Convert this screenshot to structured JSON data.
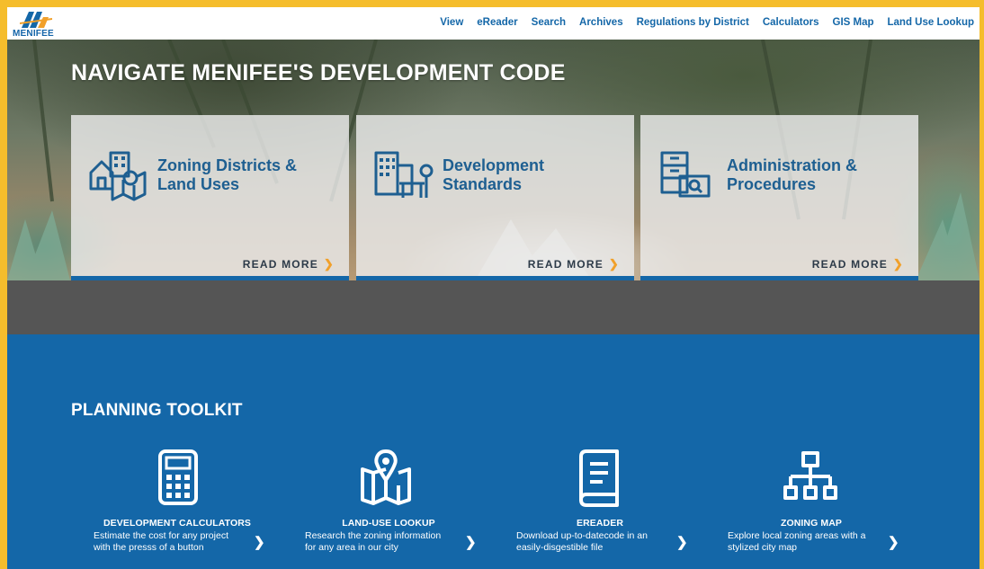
{
  "brand": {
    "name": "MENIFEE",
    "color": "#1467a8",
    "accent": "#f1a02a"
  },
  "nav": [
    "View",
    "eReader",
    "Search",
    "Archives",
    "Regulations by District",
    "Calculators",
    "GIS Map",
    "Land Use Lookup"
  ],
  "hero": {
    "title": "NAVIGATE MENIFEE'S DEVELOPMENT CODE",
    "cards": [
      {
        "icon": "zoning-map-icon",
        "title_line1": "Zoning Districts &",
        "title_line2": "Land Uses",
        "cta": "READ MORE"
      },
      {
        "icon": "buildings-bench-icon",
        "title_line1": "Development",
        "title_line2": "Standards",
        "cta": "READ MORE"
      },
      {
        "icon": "file-cabinet-search-icon",
        "title_line1": "Administration &",
        "title_line2": "Procedures",
        "cta": "READ MORE"
      }
    ]
  },
  "toolkit": {
    "title": "PLANNING TOOLKIT",
    "tools": [
      {
        "icon": "calculator-icon",
        "name": "DEVELOPMENT CALCULATORS",
        "desc_line1": "Estimate the cost for any project",
        "desc_line2": "with the presss of a button"
      },
      {
        "icon": "map-pin-icon",
        "name": "LAND-USE LOOKUP",
        "desc_line1": "Research the zoning information",
        "desc_line2": "for any area in our city"
      },
      {
        "icon": "book-icon",
        "name": "EREADER",
        "desc_line1": "Download up-to-datecode in an",
        "desc_line2": "easily-disgestible file"
      },
      {
        "icon": "sitemap-icon",
        "name": "ZONING MAP",
        "desc_line1": "Explore local zoning areas with a",
        "desc_line2": "stylized city map"
      }
    ]
  }
}
